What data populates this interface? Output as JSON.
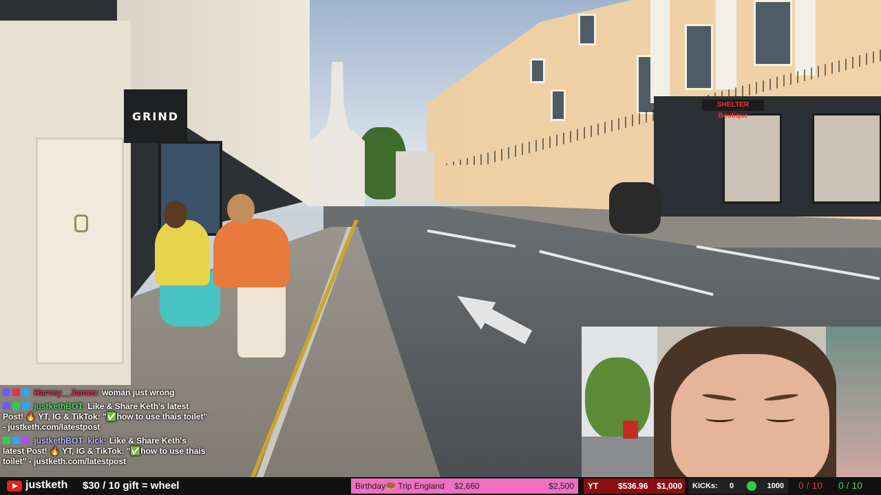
{
  "scene": {
    "shop_sign": "GRIND",
    "bakery_sign": "SHELTER Boutique"
  },
  "chat": [
    {
      "user": "Harvey__James:",
      "user_color": "#e0334a",
      "text": "woman just wrong",
      "badges": [
        "#6b5cff",
        "#e0334a",
        "#2aa7ff"
      ]
    },
    {
      "user": "justkethBOT:",
      "user_color": "#55d66b",
      "text": "Like & Share Keth's latest Post! 🔥 YT, IG & TikTok: \"✅how to use thais toilet\" - justketh.com/latestpost",
      "badges": [
        "#6b5cff",
        "#2bd04a",
        "#2aa7ff"
      ]
    },
    {
      "user": "justkethBOT_kick:",
      "user_color": "#b9b9ff",
      "text": "Like & Share Keth's latest Post! 🔥 YT, IG & TikTok: \"✅how to use thais toilet\" - justketh.com/latestpost",
      "badges": [
        "#2bd04a",
        "#2aa7ff",
        "#b04cff"
      ]
    }
  ],
  "bar": {
    "channel": "justketh",
    "gift_text": "$30 / 10 gift = wheel",
    "goal": {
      "label": "Birthday🍩 Trip England",
      "current": "$2,660",
      "target": "$2,500",
      "progress": 1.0
    },
    "yt_goal": {
      "tag": "YT",
      "current": "$536.96",
      "target": "$1,000",
      "progress": 0.537
    },
    "kicks": {
      "label": "KICKs:",
      "current": "0",
      "target": "1000"
    },
    "counter_red": "0 / 10",
    "counter_green": "0 / 10"
  },
  "colors": {
    "accent_pink": "#f06fc0",
    "yt_red": "#e62117",
    "counter_red": "#e0334a",
    "counter_green": "#3fd460"
  }
}
